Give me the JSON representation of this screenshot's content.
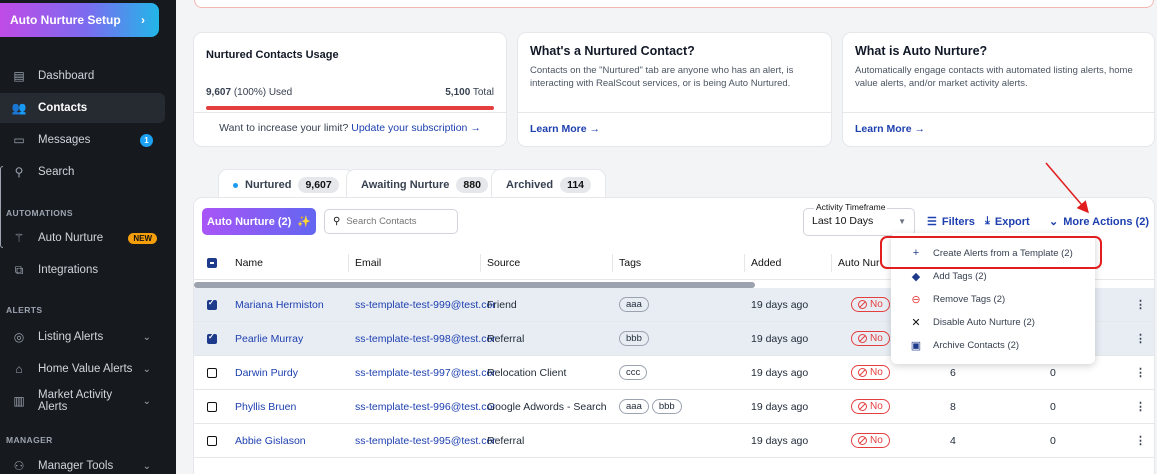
{
  "sidebar": {
    "setup_button": "Auto Nurture Setup",
    "items": [
      {
        "label": "Dashboard",
        "icon": "dashboard-icon"
      },
      {
        "label": "Contacts",
        "icon": "contacts-icon"
      },
      {
        "label": "Messages",
        "icon": "messages-icon",
        "badge": "1"
      },
      {
        "label": "Search",
        "icon": "search-icon"
      }
    ],
    "automations_title": "AUTOMATIONS",
    "automations": [
      {
        "label": "Auto Nurture",
        "icon": "wand-icon",
        "badge": "NEW"
      },
      {
        "label": "Integrations",
        "icon": "integrations-icon"
      }
    ],
    "alerts_title": "ALERTS",
    "alerts": [
      {
        "label": "Listing Alerts",
        "icon": "location-icon"
      },
      {
        "label": "Home Value Alerts",
        "icon": "home-icon"
      },
      {
        "label": "Market Activity Alerts",
        "icon": "chart-icon"
      }
    ],
    "manager_title": "MANAGER",
    "manager": [
      {
        "label": "Manager Tools",
        "icon": "manager-icon"
      }
    ]
  },
  "usage_card": {
    "title": "Nurtured Contacts Usage",
    "used": "9,607",
    "used_pct": "(100%) Used",
    "total": "5,100",
    "total_label": "Total",
    "limit_text": "Want to increase your limit?",
    "limit_link": "Update your subscription →",
    "fill_fraction": 1.0,
    "bar_color": "#e53e3e"
  },
  "info_cards": [
    {
      "title": "What's a Nurtured Contact?",
      "body": "Contacts on the \"Nurtured\" tab are anyone who has an alert, is interacting with RealScout services, or is being Auto Nurtured.",
      "link": "Learn More →"
    },
    {
      "title": "What is Auto Nurture?",
      "body": "Automatically engage contacts with automated listing alerts, home value alerts, and/or market activity alerts.",
      "link": "Learn More →"
    }
  ],
  "tabs": [
    {
      "label": "Nurtured",
      "count": "9,607"
    },
    {
      "label": "Awaiting Nurture",
      "count": "880"
    },
    {
      "label": "Archived",
      "count": "114"
    }
  ],
  "toolbar": {
    "auto_nurture_button": "Auto Nurture (2)",
    "search_placeholder": "Search Contacts",
    "timeframe_label": "Activity Timeframe",
    "timeframe_value": "Last 10 Days",
    "filters": "Filters",
    "export": "Export",
    "more_actions": "More Actions (2)"
  },
  "table": {
    "headers": [
      "Name",
      "Email",
      "Source",
      "Tags",
      "Added",
      "Auto Nur"
    ],
    "rows": [
      {
        "name": "Mariana Hermiston",
        "email": "ss-template-test-999@test.cor",
        "source": "Friend",
        "tags": [
          "aaa"
        ],
        "added": "19 days ago",
        "auto": "No",
        "c1": "",
        "c2": "",
        "selected": true
      },
      {
        "name": "Pearlie Murray",
        "email": "ss-template-test-998@test.cor",
        "source": "Referral",
        "tags": [
          "bbb"
        ],
        "added": "19 days ago",
        "auto": "No",
        "c1": "",
        "c2": "",
        "selected": true
      },
      {
        "name": "Darwin Purdy",
        "email": "ss-template-test-997@test.cor",
        "source": "Relocation Client",
        "tags": [
          "ccc"
        ],
        "added": "19 days ago",
        "auto": "No",
        "c1": "6",
        "c2": "0",
        "selected": false
      },
      {
        "name": "Phyllis Bruen",
        "email": "ss-template-test-996@test.cor",
        "source": "Google Adwords - Search",
        "tags": [
          "aaa",
          "bbb"
        ],
        "added": "19 days ago",
        "auto": "No",
        "c1": "8",
        "c2": "0",
        "selected": false
      },
      {
        "name": "Abbie Gislason",
        "email": "ss-template-test-995@test.cor",
        "source": "Referral",
        "tags": [],
        "added": "19 days ago",
        "auto": "No",
        "c1": "4",
        "c2": "0",
        "selected": false
      }
    ]
  },
  "dropdown": {
    "items": [
      {
        "label": "Create Alerts from a Template (2)",
        "icon": "plus-icon"
      },
      {
        "label": "Add Tags (2)",
        "icon": "tag-icon"
      },
      {
        "label": "Remove Tags (2)",
        "icon": "minus-circle-icon"
      },
      {
        "label": "Disable Auto Nurture (2)",
        "icon": "wand-off-icon"
      },
      {
        "label": "Archive Contacts (2)",
        "icon": "archive-icon"
      }
    ]
  },
  "colors": {
    "accent": "#1e40af",
    "danger": "#e53e3e",
    "sidebar": "#161a1f"
  }
}
